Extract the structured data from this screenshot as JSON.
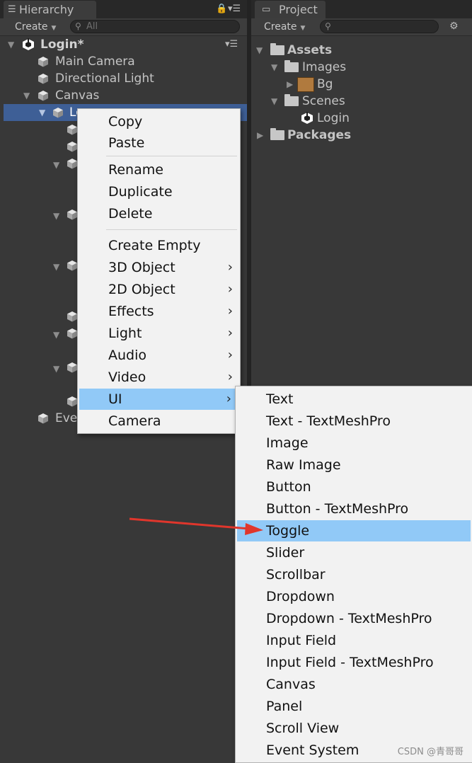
{
  "hierarchy": {
    "tab_title": "Hierarchy",
    "create_label": "Create",
    "search_placeholder": "All",
    "rows": {
      "scene": "Login*",
      "main_camera": "Main Camera",
      "directional_light": "Directional Light",
      "canvas": "Canvas",
      "selected_partial": "Lo",
      "event_partial": "Eve"
    }
  },
  "project": {
    "tab_title": "Project",
    "create_label": "Create",
    "tree": {
      "assets": "Assets",
      "images": "Images",
      "bg": "Bg",
      "scenes": "Scenes",
      "login": "Login",
      "packages": "Packages"
    }
  },
  "context_menu": {
    "copy": "Copy",
    "paste": "Paste",
    "rename": "Rename",
    "duplicate": "Duplicate",
    "delete": "Delete",
    "create_empty": "Create Empty",
    "object_3d": "3D Object",
    "object_2d": "2D Object",
    "effects": "Effects",
    "light": "Light",
    "audio": "Audio",
    "video": "Video",
    "ui": "UI",
    "camera": "Camera",
    "submenu_arrow": "›"
  },
  "ui_submenu": {
    "items": [
      "Text",
      "Text - TextMeshPro",
      "Image",
      "Raw Image",
      "Button",
      "Button - TextMeshPro",
      "Toggle",
      "Slider",
      "Scrollbar",
      "Dropdown",
      "Dropdown - TextMeshPro",
      "Input Field",
      "Input Field - TextMeshPro",
      "Canvas",
      "Panel",
      "Scroll View",
      "Event System"
    ],
    "highlighted": "Toggle"
  },
  "watermark": "CSDN @青哥哥",
  "colors": {
    "menu_highlight": "#91c9f7",
    "selection": "#3e5f96",
    "arrow_annotation": "#e0362c"
  }
}
